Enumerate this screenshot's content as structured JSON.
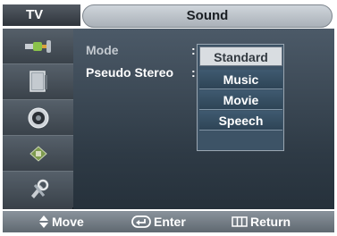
{
  "header": {
    "tv_label": "TV",
    "title": "Sound"
  },
  "sidebar": {
    "items": [
      {
        "icon": "input-plug-icon"
      },
      {
        "icon": "picture-panel-icon"
      },
      {
        "icon": "speaker-icon"
      },
      {
        "icon": "channel-chip-icon"
      },
      {
        "icon": "setup-tools-icon"
      }
    ]
  },
  "menu": {
    "mode_label": "Mode",
    "pseudo_stereo_label": "Pseudo Stereo",
    "colon": ":"
  },
  "dropdown": {
    "options": [
      "Standard",
      "Music",
      "Movie",
      "Speech"
    ],
    "selected": "Standard"
  },
  "footer": {
    "move_label": "Move",
    "enter_label": "Enter",
    "return_label": "Return"
  },
  "colors": {
    "panel": "#2e3a45",
    "sidebar": "#3b424a",
    "selected_option": "#d9dde1",
    "footer": "#6f7881"
  }
}
